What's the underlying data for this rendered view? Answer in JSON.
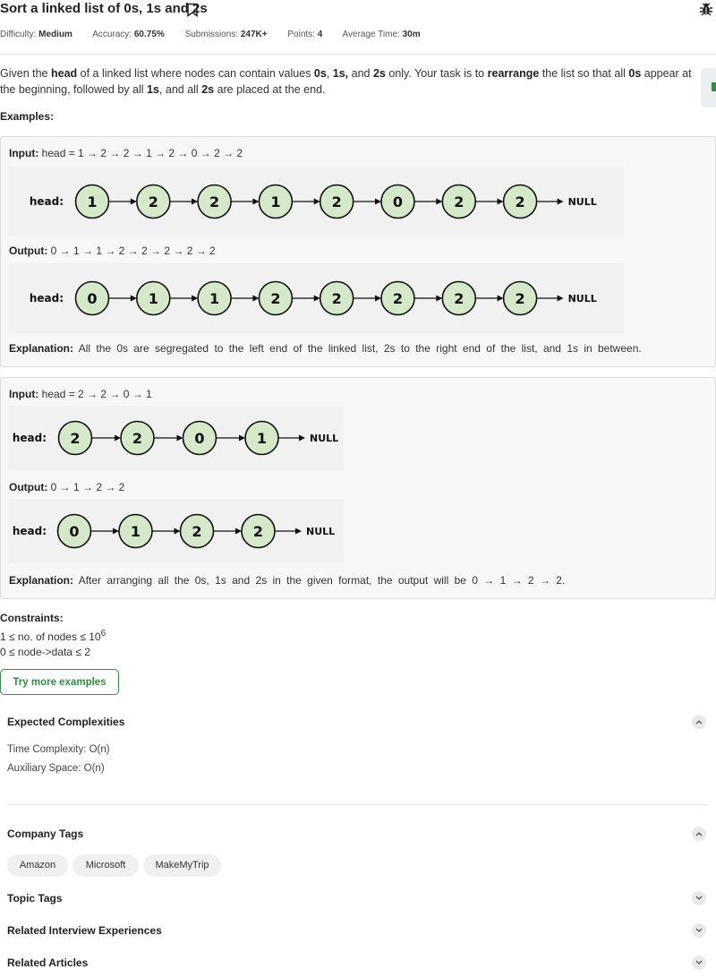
{
  "title": "Sort a linked list of 0s, 1s and 2s",
  "meta": [
    {
      "label": "Difficulty:",
      "value": "Medium"
    },
    {
      "label": "Accuracy:",
      "value": "60.75%"
    },
    {
      "label": "Submissions:",
      "value": "247K+"
    },
    {
      "label": "Points:",
      "value": "4"
    },
    {
      "label": "Average Time:",
      "value": "30m"
    }
  ],
  "description": {
    "t1": "Given the ",
    "b1": "head",
    "t2": " of a linked list where nodes can contain values ",
    "b2": "0s",
    "t3": ", ",
    "b3": "1s,",
    "t4": " and ",
    "b4": "2s",
    "t5": " only. Your task is to ",
    "b5": "rearrange",
    "t6": " the list so that all ",
    "b6": "0s",
    "t7": " appear at the beginning, followed by all ",
    "b7": "1s",
    "t8": ", and all ",
    "b8": "2s",
    "t9": " are placed at the end."
  },
  "examples_label": "Examples:",
  "labels": {
    "input": "Input:",
    "output": "Output:",
    "explanation": "Explanation:",
    "head": "head:",
    "null": "NULL"
  },
  "examples": [
    {
      "input": "head = 1 → 2 → 2 → 1 → 2 → 0 → 2 → 2",
      "input_nodes": [
        "1",
        "2",
        "2",
        "1",
        "2",
        "0",
        "2",
        "2"
      ],
      "output": "0 → 1 → 1 → 2 → 2 → 2 → 2 → 2",
      "output_nodes": [
        "0",
        "1",
        "1",
        "2",
        "2",
        "2",
        "2",
        "2"
      ],
      "explanation": "All the 0s are segregated to the left end of the linked list, 2s to the right end of the list, and 1s in between."
    },
    {
      "input": "head = 2 → 2 → 0 → 1",
      "input_nodes": [
        "2",
        "2",
        "0",
        "1"
      ],
      "output": "0 → 1 → 2 → 2",
      "output_nodes": [
        "0",
        "1",
        "2",
        "2"
      ],
      "explanation": "After arranging all the 0s, 1s and 2s in the given format, the output will be 0 → 1 → 2 → 2."
    }
  ],
  "constraints": {
    "label": "Constraints:",
    "c1_prefix": "1 ≤ no. of nodes ≤ 10",
    "c1_exp": "6",
    "c2": "0 ≤ node->data ≤ 2"
  },
  "try_button": "Try more examples",
  "expected_complexities": {
    "heading": "Expected Complexities",
    "time": "Time Complexity: O(n)",
    "space": "Auxiliary Space: O(n)"
  },
  "company_tags": {
    "heading": "Company Tags",
    "tags": [
      "Amazon",
      "Microsoft",
      "MakeMyTrip"
    ]
  },
  "topic_tags": {
    "heading": "Topic Tags"
  },
  "related_interview": {
    "heading": "Related Interview Experiences"
  },
  "related_articles": {
    "heading": "Related Articles"
  },
  "colors": {
    "accent": "#2f8d46",
    "node_fill": "#d5e8c9"
  }
}
